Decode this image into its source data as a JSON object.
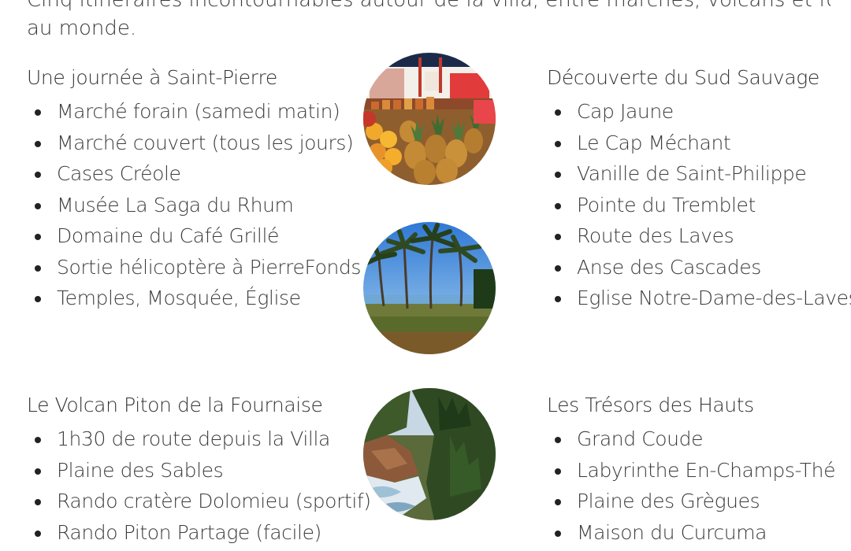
{
  "intro": {
    "line1": "Cinq itinéraires incontournables autour de la villa, entre marchés, volcans et forêts parmi les plus beaux",
    "line2": "au monde."
  },
  "sections": {
    "saint_pierre": {
      "title": "Une journée à Saint-Pierre",
      "items": [
        "Marché forain (samedi matin)",
        "Marché couvert (tous les jours)",
        "Cases Créole",
        "Musée La Saga du Rhum",
        "Domaine du Café Grillé",
        "Sortie hélicoptère à PierreFonds",
        "Temples, Mosquée, Église"
      ]
    },
    "sud_sauvage": {
      "title": "Découverte du Sud Sauvage",
      "items": [
        "Cap Jaune",
        "Le Cap Méchant",
        "Vanille de Saint-Philippe",
        "Pointe du Tremblet",
        "Route des Laves",
        "Anse des Cascades",
        "Eglise Notre-Dame-des-Laves"
      ]
    },
    "volcan": {
      "title": "Le Volcan Piton de la Fournaise",
      "items": [
        "1h30 de route depuis la Villa",
        "Plaine des Sables",
        "Rando cratère Dolomieu (sportif)",
        "Rando Piton Partage (facile)"
      ]
    },
    "hauts": {
      "title": "Les Trésors des Hauts",
      "items": [
        "Grand Coude",
        "Labyrinthe En-Champs-Thé",
        "Plaine des Grègues",
        "Maison du Curcuma"
      ]
    }
  },
  "images": {
    "market": "market-fruits-photo",
    "beach": "palm-beach-photo",
    "cliff": "coastal-cliff-photo"
  }
}
